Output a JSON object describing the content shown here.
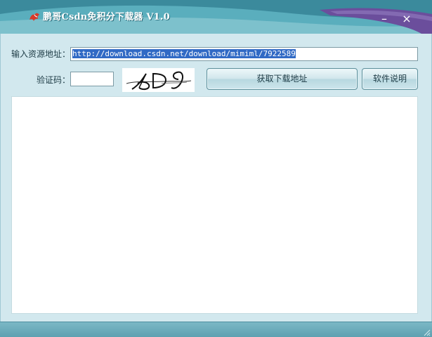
{
  "window": {
    "title": "鹏哥Csdn免积分下载器 V1.0",
    "minimize_glyph": "–",
    "close_glyph": "×"
  },
  "form": {
    "url_label": "输入资源地址：",
    "url_value": "http://download.csdn.net/download/mimiml/7922589",
    "code_label": "验证码：",
    "code_value": "",
    "captcha_text": "AD9"
  },
  "buttons": {
    "get_address": "获取下载地址",
    "help": "软件说明"
  },
  "output": {
    "text": ""
  },
  "colors": {
    "titlebar": "#4c9fb0",
    "panel": "#d2e8ee",
    "selection": "#316ac5",
    "accent_purple": "#6b4e9c"
  },
  "icons": {
    "app": "app-logo-icon",
    "minimize": "minimize-icon",
    "close": "close-icon",
    "resize": "resize-grip-icon"
  }
}
